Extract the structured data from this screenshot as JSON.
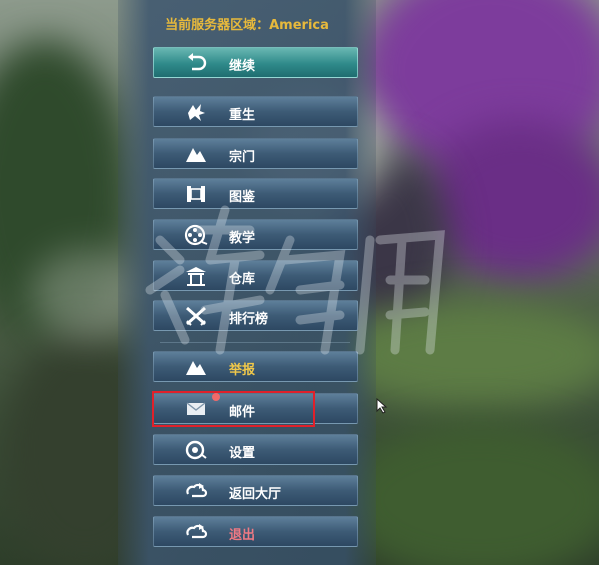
{
  "server_label": "当前服务器区域：America",
  "menu": {
    "continue": "继续",
    "rebirth": "重生",
    "sect": "宗门",
    "atlas": "图鉴",
    "tutorial": "教学",
    "warehouse": "仓库",
    "leaderboard": "排行榜",
    "report": "举报",
    "mail": "邮件",
    "settings": "设置",
    "return_lobby": "返回大厅",
    "exit": "退出"
  },
  "colors": {
    "highlight": "#e0202a",
    "server_text": "#e7b93c",
    "exit_text": "#f07a84",
    "report_text": "#f0c84a"
  }
}
